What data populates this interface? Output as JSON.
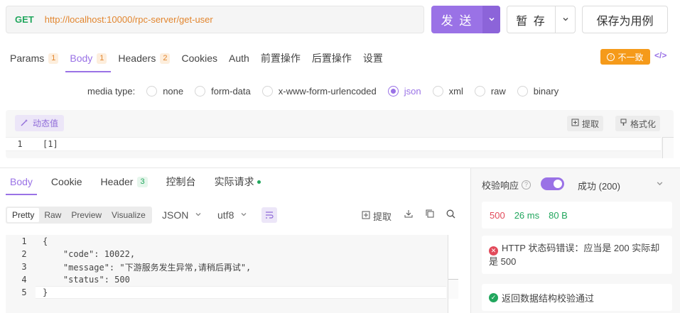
{
  "request": {
    "method": "GET",
    "url": "http://localhost:10000/rpc-server/get-user",
    "send_label": "发 送",
    "save_label": "暂 存",
    "save_case_label": "保存为用例"
  },
  "req_tabs": [
    {
      "label": "Params",
      "badge": "1"
    },
    {
      "label": "Body",
      "badge": "1"
    },
    {
      "label": "Headers",
      "badge": "2"
    },
    {
      "label": "Cookies"
    },
    {
      "label": "Auth"
    },
    {
      "label": "前置操作"
    },
    {
      "label": "后置操作"
    },
    {
      "label": "设置"
    }
  ],
  "mismatch_label": "不一致",
  "code_toggle": "</>",
  "media": {
    "label": "media type:",
    "options": [
      "none",
      "form-data",
      "x-www-form-urlencoded",
      "json",
      "xml",
      "raw",
      "binary"
    ],
    "selected": "json"
  },
  "editor": {
    "dynamic_label": "动态值",
    "extract_label": "提取",
    "format_label": "格式化",
    "line_no": "1",
    "content": "[1]"
  },
  "res_tabs": [
    {
      "label": "Body"
    },
    {
      "label": "Cookie"
    },
    {
      "label": "Header",
      "badge": "3"
    },
    {
      "label": "控制台"
    },
    {
      "label": "实际请求"
    }
  ],
  "res_toolbar": {
    "views": [
      "Pretty",
      "Raw",
      "Preview",
      "Visualize"
    ],
    "active_view": "Pretty",
    "format": "JSON",
    "encoding": "utf8",
    "extract_label": "提取"
  },
  "response_lines": [
    {
      "n": "1",
      "text": "{"
    },
    {
      "n": "2",
      "text": "    \"code\": 10022,"
    },
    {
      "n": "3",
      "text": "    \"message\": \"下游服务发生异常,请稍后再试\","
    },
    {
      "n": "4",
      "text": "    \"status\": 500"
    },
    {
      "n": "5",
      "text": "}"
    }
  ],
  "validation": {
    "title": "校验响应",
    "result": "成功 (200)",
    "status_code": "500",
    "time": "26 ms",
    "size": "80 B",
    "error_text": "HTTP 状态码错误：应当是 200 实际却是 500",
    "ok_text": "返回数据结构校验通过"
  },
  "colors": {
    "accent": "#9a72e6",
    "method_green": "#21a65d",
    "url_orange": "#e2862f",
    "warn": "#f59a1a",
    "error": "#e24a5a"
  }
}
